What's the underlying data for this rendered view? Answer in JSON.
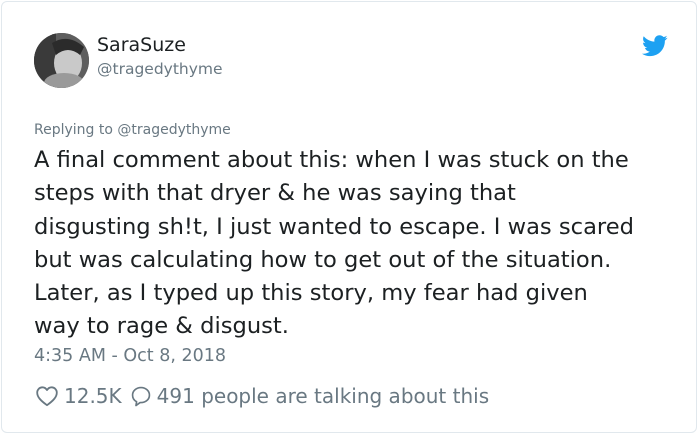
{
  "author": {
    "name": "SaraSuze",
    "handle": "@tragedythyme"
  },
  "reply": {
    "prefix": "Replying to",
    "to": "@tragedythyme"
  },
  "tweet": {
    "lines": [
      "A final comment about this: when I was stuck on the",
      "steps with that dryer & he was saying that",
      "disgusting sh!t, I just wanted to escape. I was scared",
      "but was calculating how to get out of the situation.",
      "Later, as I typed up this story, my fear had given",
      "way to rage & disgust."
    ],
    "timestamp": "4:35 AM - Oct 8, 2018"
  },
  "actions": {
    "likes": "12.5K",
    "talking": "491 people are talking about this"
  },
  "colors": {
    "twitter_blue": "#1da1f2",
    "secondary_text": "#697882",
    "primary_text": "#1c2022",
    "border": "#e1e8ed"
  },
  "icons": {
    "bird": "twitter-bird-icon",
    "like": "heart-icon",
    "reply": "speech-bubble-icon"
  }
}
